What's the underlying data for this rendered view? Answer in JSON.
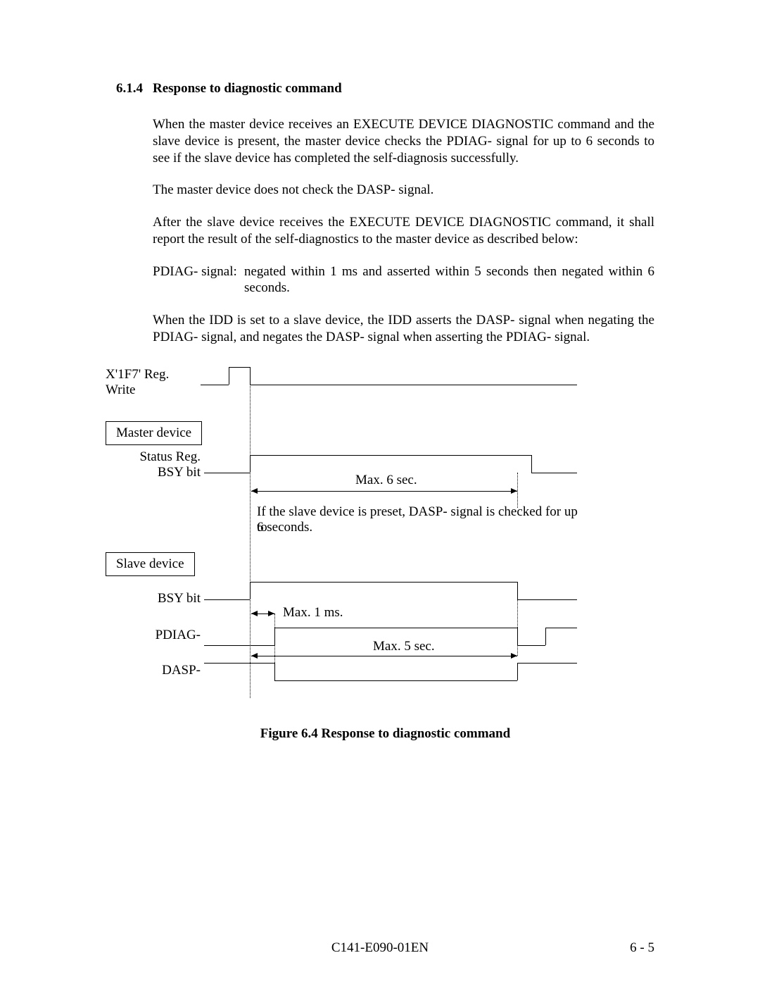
{
  "section": {
    "number": "6.1.4",
    "title": "Response to diagnostic command"
  },
  "paragraphs": {
    "p1": "When the master device receives an EXECUTE DEVICE DIAGNOSTIC command and the slave device is present, the master device checks the PDIAG- signal for up to 6 seconds to see if the slave device has completed the self-diagnosis successfully.",
    "p2": "The master device does not check the DASP- signal.",
    "p3": "After the slave device receives the EXECUTE DEVICE DIAGNOSTIC command, it shall report the result of the self-diagnostics to the master device as described below:",
    "p4_label": "PDIAG- signal:",
    "p4_text": "negated within 1 ms and asserted within 5 seconds then negated within 6 seconds.",
    "p5": "When the IDD is set to a slave device, the IDD asserts the DASP- signal when negating the PDIAG- signal, and negates the DASP- signal when asserting the PDIAG- signal."
  },
  "diagram": {
    "reg_label_1": "X'1F7' Reg.",
    "reg_label_2": "Write",
    "master_box": "Master device",
    "status_label_1": "Status Reg.",
    "status_label_2": "BSY bit",
    "max6": "Max. 6 sec.",
    "note_line1": "If the slave device is preset, DASP- signal is checked for up to",
    "note_line2": "6 seconds.",
    "slave_box": "Slave device",
    "bsy_label": "BSY bit",
    "max1": "Max. 1 ms.",
    "pdiag_label": "PDIAG-",
    "max5": "Max. 5 sec.",
    "dasp_label": "DASP-"
  },
  "figure_caption": "Figure 6.4     Response to diagnostic command",
  "footer": {
    "center": "C141-E090-01EN",
    "right": "6 - 5"
  }
}
